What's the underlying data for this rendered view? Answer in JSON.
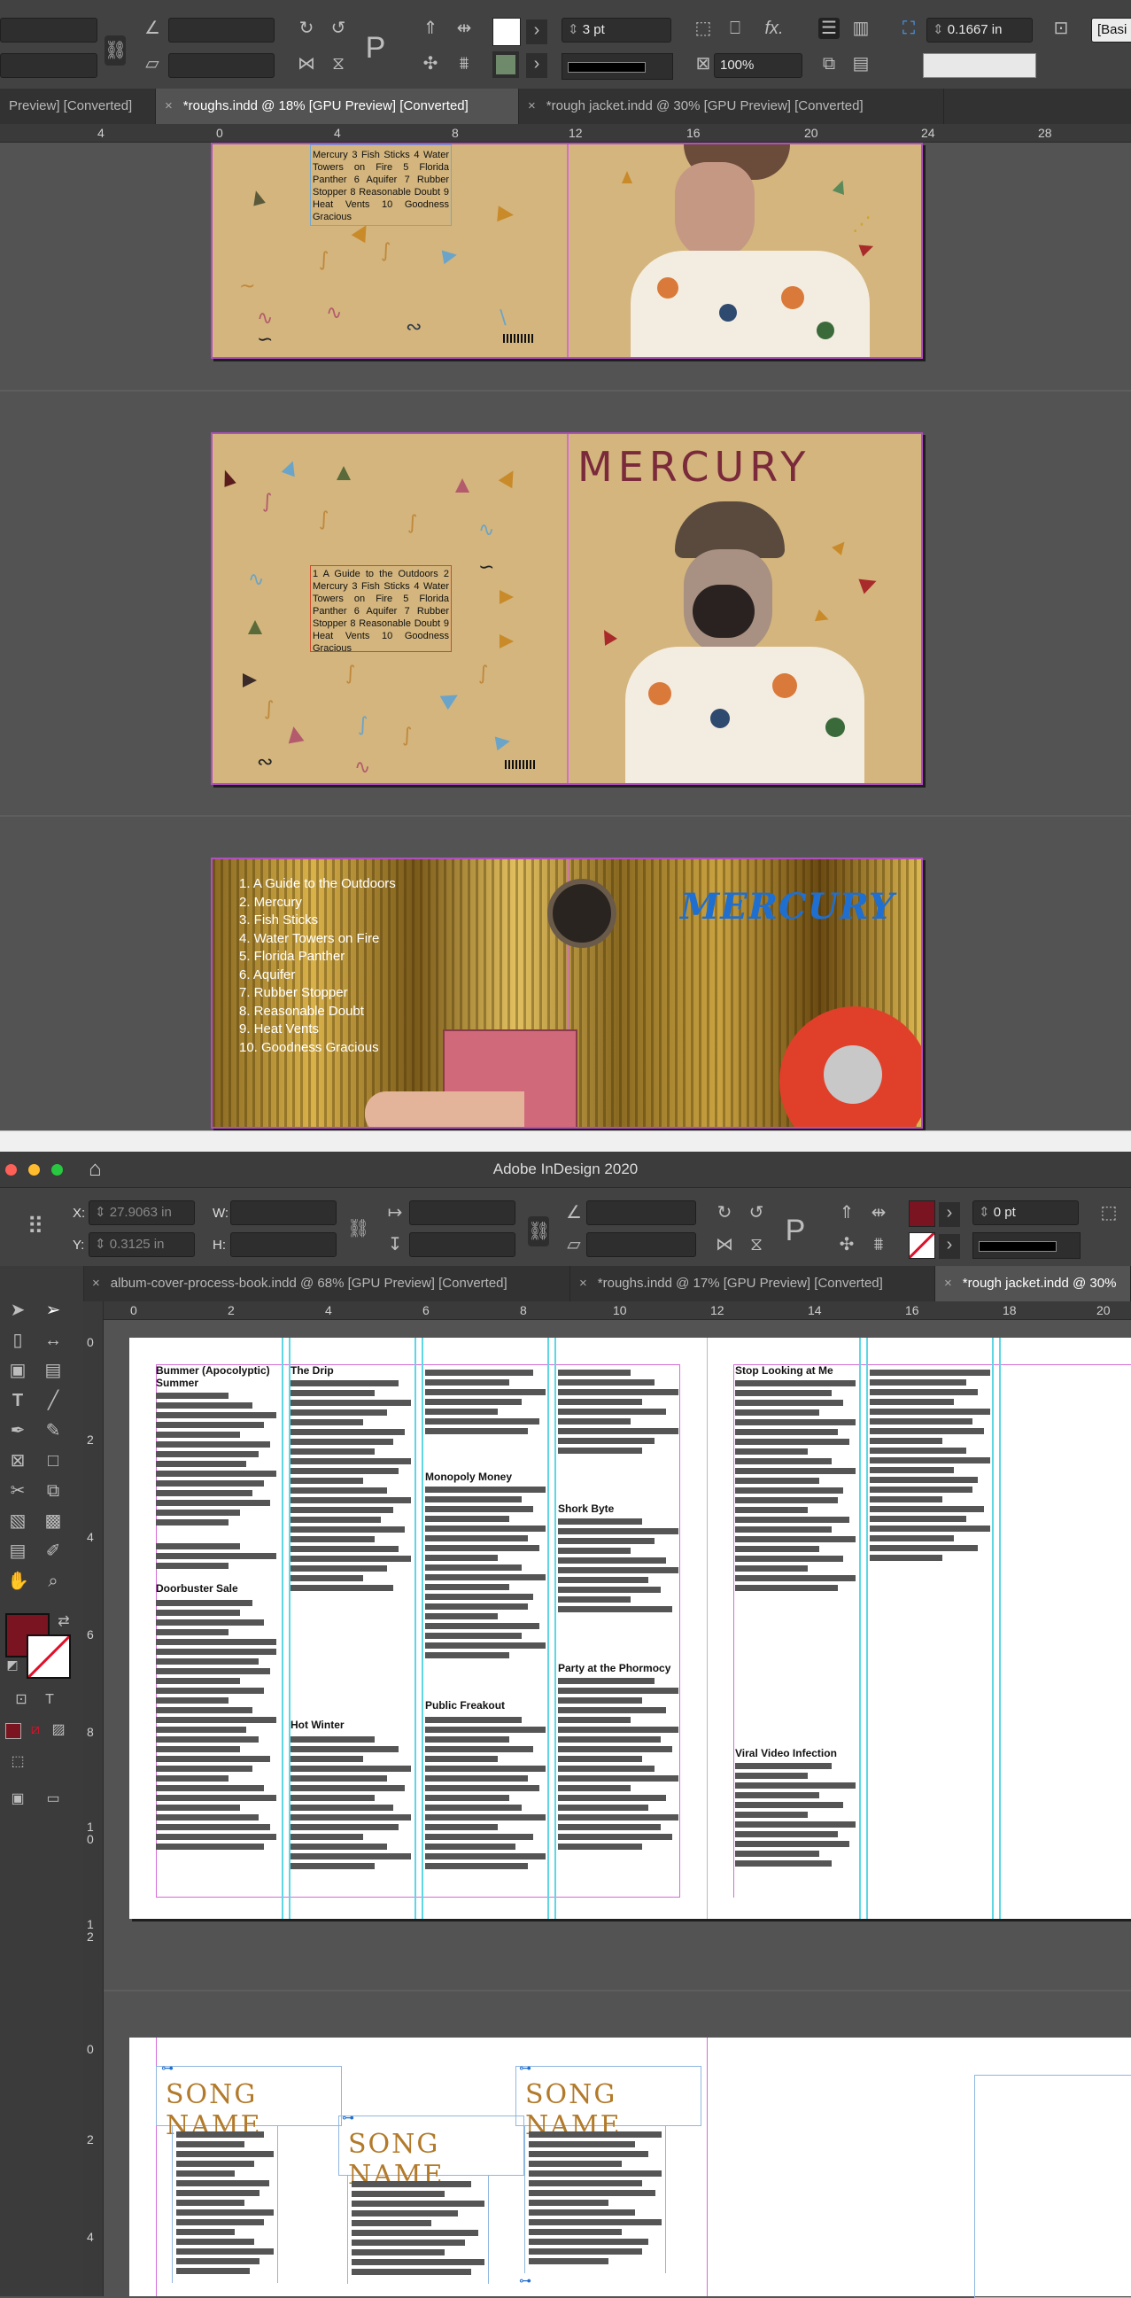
{
  "top_window": {
    "control_panel": {
      "stroke_weight": "3 pt",
      "scale_percent": "100%",
      "offset_value": "0.1667 in",
      "style_label": "[Basi"
    },
    "tabs": [
      {
        "label": "Preview] [Converted]",
        "active": false
      },
      {
        "label": "*roughs.indd @ 18% [GPU Preview] [Converted]",
        "active": true
      },
      {
        "label": "*rough jacket.indd @ 30% [GPU Preview] [Converted]",
        "active": false
      }
    ],
    "ruler_labels": [
      "4",
      "0",
      "4",
      "8",
      "12",
      "16",
      "20",
      "24",
      "28"
    ],
    "spread_2": {
      "title": "MERCURY",
      "tracklist": "1 A Guide to the Outdoors 2 Mercury 3 Fish Sticks 4 Water Towers on Fire 5 Florida Panther 6 Aquifer 7 Rubber Stopper 8 Reasonable Doubt 9 Heat Vents 10 Goodness Gracious"
    },
    "spread_1_tracklist": "Mercury 3 Fish Sticks 4 Water Towers on Fire 5 Florida Panther 6 Aquifer 7 Rubber Stopper 8 Reasonable Doubt 9 Heat Vents 10 Goodness Gracious",
    "spread_3": {
      "title": "MERCURY",
      "tracks": [
        "1. A Guide to the Outdoors",
        "2. Mercury",
        "3. Fish Sticks",
        "4. Water Towers on Fire",
        "5. Florida Panther",
        "6. Aquifer",
        "7. Rubber Stopper",
        "8. Reasonable Doubt",
        "9. Heat Vents",
        "10. Goodness Gracious"
      ]
    }
  },
  "bottom_window": {
    "app_title": "Adobe InDesign 2020",
    "control_panel": {
      "x_label": "X:",
      "x_value": "27.9063 in",
      "y_label": "Y:",
      "y_value": "0.3125 in",
      "w_label": "W:",
      "h_label": "H:",
      "stroke_weight": "0 pt"
    },
    "tabs": [
      {
        "label": "album-cover-process-book.indd @ 68% [GPU Preview] [Converted]",
        "active": false
      },
      {
        "label": "*roughs.indd @ 17% [GPU Preview] [Converted]",
        "active": false
      },
      {
        "label": "*rough jacket.indd @ 30%",
        "active": true
      }
    ],
    "ruler_labels": [
      "0",
      "2",
      "4",
      "6",
      "8",
      "10",
      "12",
      "14",
      "16",
      "18",
      "20"
    ],
    "vruler_labels": [
      "0",
      "2",
      "4",
      "6",
      "8",
      "1\n0",
      "1\n2",
      "0",
      "2",
      "4"
    ],
    "lyric_headings": [
      "Bummer (Apocolyptic) Summer",
      "The Drip",
      "Monopoly Money",
      "Shork Byte",
      "Doorbuster Sale",
      "Party at the Phormocy",
      "Public Freakout",
      "Hot Winter",
      "Stop Looking at Me",
      "Viral Video Infection"
    ],
    "song_name_label": "SONG NAME"
  },
  "colors": {
    "fill_swatch": "#7a1420",
    "cover_bg": "#d3b57d",
    "guide": "#5fd6e4",
    "margin": "#d56cd6"
  }
}
